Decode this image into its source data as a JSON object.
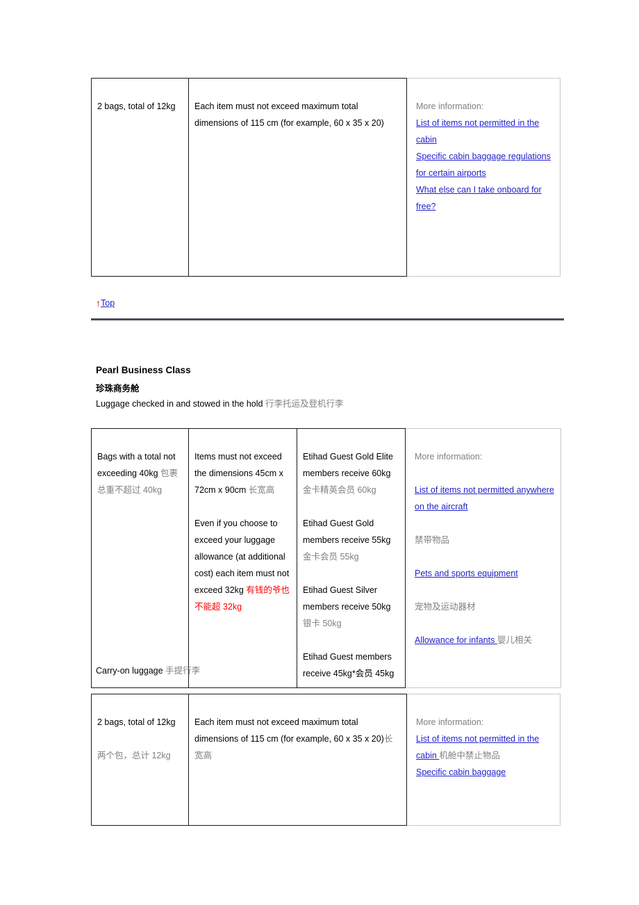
{
  "table_cabin_top": {
    "col1": "2 bags, total of 12kg",
    "col2": "Each item must not exceed maximum total dimensions of 115 cm (for example, 60 x 35 x 20)",
    "col3": {
      "more_info_label": "More information:",
      "links": [
        "List of items not permitted in the cabin",
        "Specific cabin baggage regulations for certain airports",
        "What else can I take onboard for free?"
      ]
    }
  },
  "top_link": {
    "arrow_icon": "up-arrow-icon",
    "arrow_glyph": "↑",
    "label": "Top",
    "arrow_color": "#dd0000",
    "link_color": "#2222cc"
  },
  "section": {
    "heading_en": "Pearl Business Class",
    "heading_cn": "珍珠商务舱",
    "subheading_hold_en": "Luggage checked in and stowed in the hold ",
    "subheading_hold_cn": "行李托运及登机行李",
    "subheading_carry_en": "Carry-on luggage ",
    "subheading_carry_cn": "手提行李"
  },
  "table_hold": {
    "col1": {
      "line1_en": "Bags with a total not exceeding 40kg ",
      "line1_cn": "包裹总重不超过 40kg"
    },
    "col2": {
      "para1_en": "Items must not exceed the dimensions 45cm x 72cm x 90cm ",
      "para1_cn": "长宽高",
      "para2_en": "Even if you choose to exceed your luggage allowance (at additional cost) each item must not exceed 32kg ",
      "para2_red": "有钱的爷也不能超 32kg"
    },
    "col3": {
      "rows": [
        {
          "en": "Etihad Guest Gold Elite members receive 60kg ",
          "cn": "金卡精英会员 60kg"
        },
        {
          "en": "Etihad Guest Gold members receive 55kg ",
          "cn": "金卡会员 55kg"
        },
        {
          "en": "Etihad Guest Silver members receive 50kg ",
          "cn": "银卡 50kg"
        },
        {
          "en": "Etihad Guest members receive 45kg*",
          "cn": "会员 45kg"
        }
      ]
    },
    "col4": {
      "more_info_label": "More information:",
      "entries": [
        {
          "link": "List of items not permitted anywhere on the aircraft",
          "cn": "禁带物品"
        },
        {
          "link": "Pets and sports equipment",
          "cn": "宠物及运动器材"
        },
        {
          "link": "Allowance for infants ",
          "cn": "婴儿相关"
        }
      ]
    }
  },
  "table_carry": {
    "col1": {
      "line1_en": "2 bags, total of 12kg",
      "line2_cn": "两个包，总计 12kg"
    },
    "col2": {
      "text_en": "Each item must not exceed maximum total dimensions of 115 cm (for example, 60 x 35 x 20)",
      "text_cn": "长宽高"
    },
    "col3": {
      "more_info_label": "More information:",
      "entry1_link": "List of items not permitted in the cabin ",
      "entry1_cn": "机舱中禁止物品",
      "entry2_link": "Specific cabin baggage "
    }
  }
}
